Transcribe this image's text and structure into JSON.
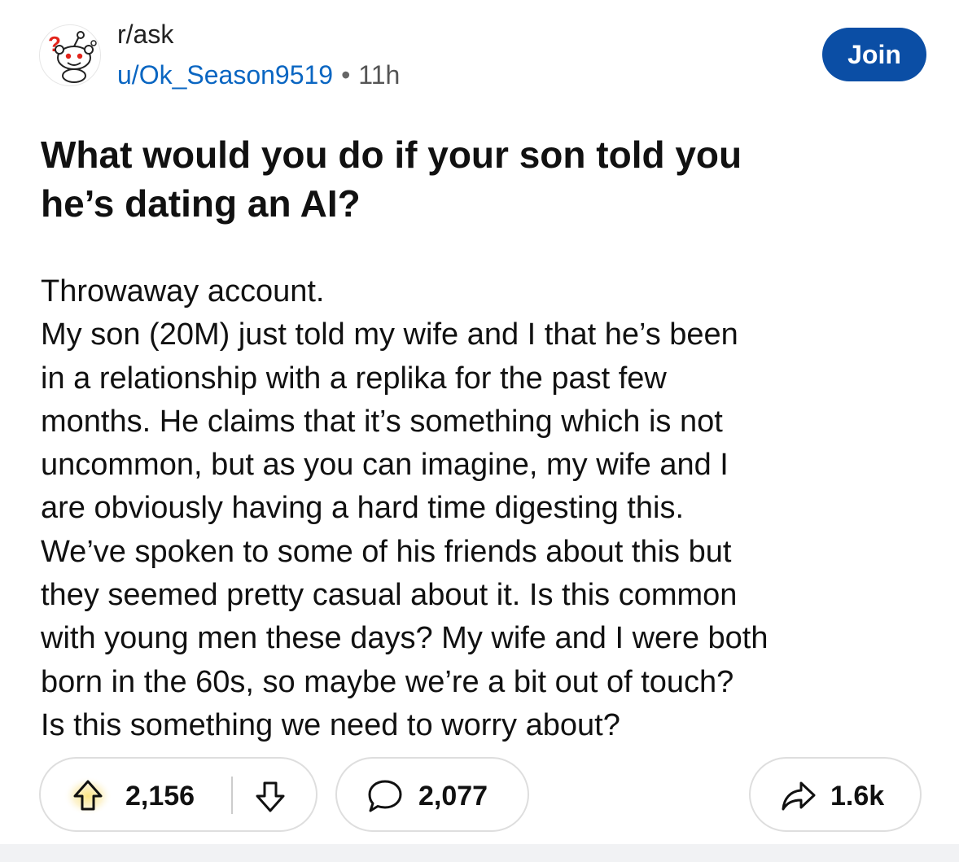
{
  "post": {
    "subreddit": "r/ask",
    "username": "u/Ok_Season9519",
    "separator": "•",
    "age": "11h",
    "join_label": "Join",
    "title_lines": [
      "What would you do if your son told you",
      "he’s dating an AI?"
    ],
    "body_lines": [
      "Throwaway account.",
      "My son (20M) just told my wife and I that he’s been",
      "in a relationship with a replika for the past few",
      "months. He claims that it’s something which is not",
      "uncommon, but as you can imagine, my wife and I",
      "are obviously having a hard time digesting this.",
      "We’ve spoken to some of his friends about this but",
      "they seemed pretty casual about it. Is this common",
      "with young men these days? My wife and I were both",
      "born in the 60s, so maybe we’re a bit out of touch?",
      "Is this something we need to worry about?"
    ]
  },
  "actions": {
    "upvote_count": "2,156",
    "comment_count": "2,077",
    "share_count": "1.6k"
  },
  "icons": {
    "avatar": "snoo-question-avatar-icon",
    "upvote": "arrow-up-icon",
    "downvote": "arrow-down-icon",
    "comment": "speech-bubble-icon",
    "share": "share-arrow-icon"
  },
  "colors": {
    "join_button": "#0b4ea5",
    "username": "#0a66c2",
    "upvote_glow": "#f7d44a"
  }
}
